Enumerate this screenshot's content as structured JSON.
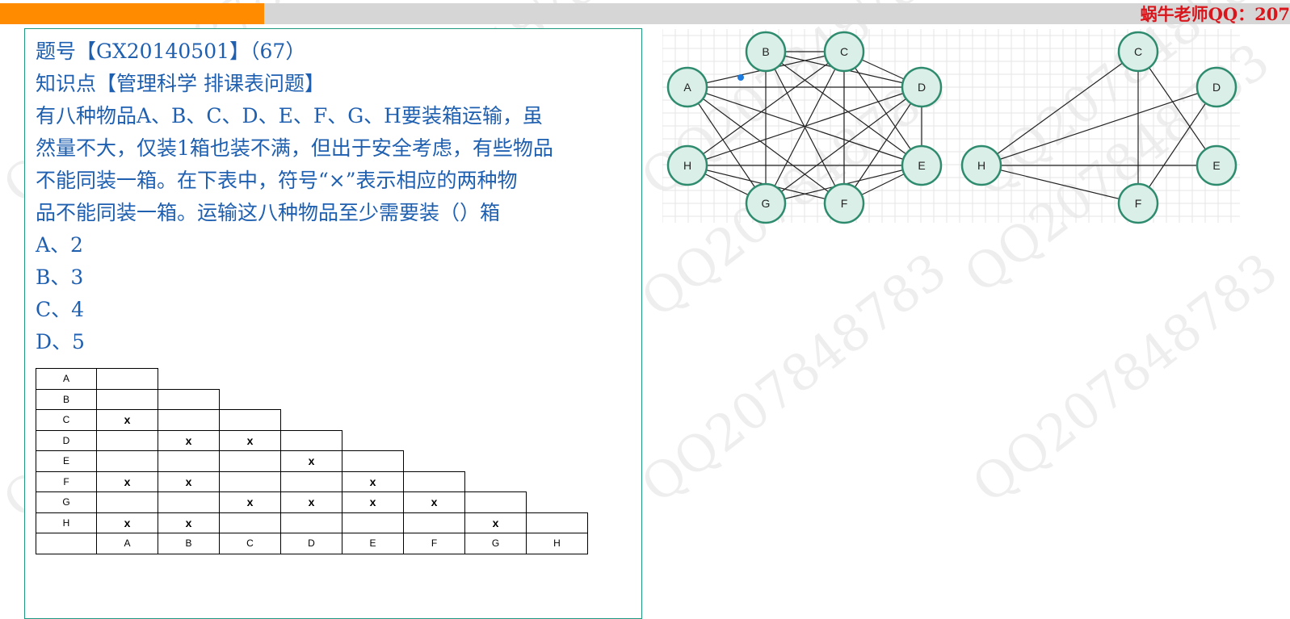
{
  "header": {
    "progress_percent": 20.5,
    "contact": "蜗牛老师QQ：207"
  },
  "question": {
    "id_line": "题号【GX20140501】（67）",
    "topic_line": "知识点【管理科学 排课表问题】",
    "body_lines": [
      "有八种物品A、B、C、D、E、F、G、H要装箱运输，虽",
      "然量不大，仅装1箱也装不满，但出于安全考虑，有些物品",
      "不能同装一箱。在下表中，符号“×”表示相应的两种物",
      "品不能同装一箱。运输这八种物品至少需要装（）箱"
    ],
    "options": [
      "A、2",
      "B、3",
      "C、4",
      "D、5"
    ]
  },
  "matrix": {
    "labels": [
      "A",
      "B",
      "C",
      "D",
      "E",
      "F",
      "G",
      "H"
    ],
    "mark": "x",
    "conflicts": [
      [
        "C",
        "A"
      ],
      [
        "D",
        "B"
      ],
      [
        "D",
        "C"
      ],
      [
        "E",
        "D"
      ],
      [
        "F",
        "A"
      ],
      [
        "F",
        "B"
      ],
      [
        "F",
        "E"
      ],
      [
        "G",
        "C"
      ],
      [
        "G",
        "D"
      ],
      [
        "G",
        "E"
      ],
      [
        "G",
        "F"
      ],
      [
        "H",
        "A"
      ],
      [
        "H",
        "B"
      ],
      [
        "H",
        "G"
      ]
    ]
  },
  "graph1": {
    "nodes": [
      "A",
      "B",
      "C",
      "D",
      "E",
      "F",
      "G",
      "H"
    ],
    "edges": [
      [
        "A",
        "C"
      ],
      [
        "A",
        "D"
      ],
      [
        "A",
        "E"
      ],
      [
        "A",
        "F"
      ],
      [
        "A",
        "G"
      ],
      [
        "B",
        "C"
      ],
      [
        "B",
        "D"
      ],
      [
        "B",
        "E"
      ],
      [
        "B",
        "F"
      ],
      [
        "B",
        "G"
      ],
      [
        "C",
        "D"
      ],
      [
        "C",
        "E"
      ],
      [
        "C",
        "F"
      ],
      [
        "C",
        "G"
      ],
      [
        "C",
        "H"
      ],
      [
        "D",
        "E"
      ],
      [
        "D",
        "F"
      ],
      [
        "D",
        "G"
      ],
      [
        "D",
        "H"
      ],
      [
        "E",
        "F"
      ],
      [
        "E",
        "G"
      ],
      [
        "E",
        "H"
      ],
      [
        "F",
        "H"
      ],
      [
        "G",
        "H"
      ]
    ]
  },
  "graph2": {
    "nodes": [
      "C",
      "D",
      "E",
      "F",
      "H"
    ],
    "edges": [
      [
        "C",
        "H"
      ],
      [
        "C",
        "E"
      ],
      [
        "C",
        "F"
      ],
      [
        "D",
        "H"
      ],
      [
        "D",
        "F"
      ],
      [
        "E",
        "H"
      ],
      [
        "F",
        "H"
      ]
    ]
  },
  "watermark": "QQ207848783",
  "colors": {
    "accent": "#ff8c00",
    "question_text": "#1f5fb0",
    "contact_text": "#d8161c",
    "node_fill": "#d9efe8",
    "node_stroke": "#2e8b6e",
    "card_border": "#1f9a80"
  }
}
